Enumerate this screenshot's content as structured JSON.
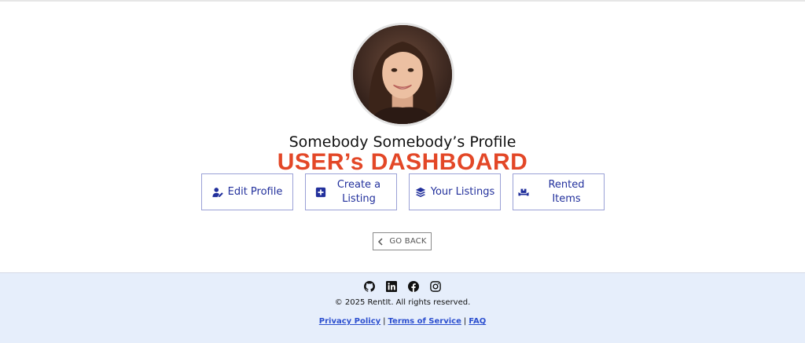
{
  "profile": {
    "title": "Somebody Somebody’s Profile",
    "dashboard_title": "USER’s DASHBOARD",
    "avatar_alt": "profile photo"
  },
  "actions": [
    {
      "label": "Edit Profile",
      "icon": "user-edit-icon"
    },
    {
      "label": "Create a Listing",
      "icon": "plus-square-icon"
    },
    {
      "label": "Your Listings",
      "icon": "layers-icon"
    },
    {
      "label": "Rented Items",
      "icon": "people-carry-icon"
    }
  ],
  "back": {
    "label": "GO BACK",
    "icon": "chevron-left-icon"
  },
  "footer": {
    "social": [
      "github-icon",
      "linkedin-icon",
      "facebook-icon",
      "instagram-icon"
    ],
    "copyright": "© 2025 RentIt. All rights reserved.",
    "links": [
      {
        "label": "Privacy Policy"
      },
      {
        "label": "Terms of Service"
      },
      {
        "label": "FAQ"
      }
    ],
    "separator": "|"
  },
  "colors": {
    "accent": "#22309c",
    "dashboard_red": "#e34727",
    "footer_bg": "#e6eefb",
    "link_blue": "#2c4fcf"
  }
}
